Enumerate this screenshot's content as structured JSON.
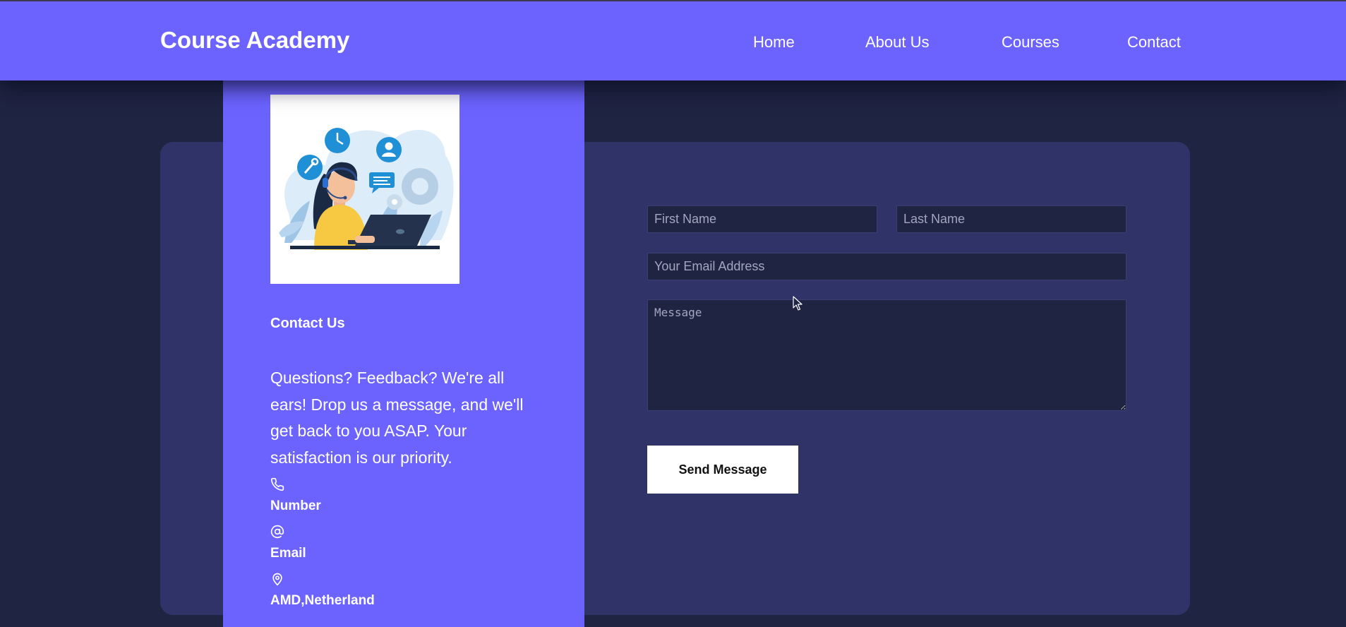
{
  "header": {
    "brand": "Course Academy",
    "nav": [
      "Home",
      "About Us",
      "Courses",
      "Contact"
    ]
  },
  "contact_panel": {
    "illustration": "support-agent-illustration",
    "title": "Contact Us",
    "text": "Questions? Feedback? We're all ears! Drop us a message, and we'll get back to you ASAP. Your satisfaction is our priority.",
    "items": [
      {
        "icon": "phone-icon",
        "label": "Number"
      },
      {
        "icon": "at-icon",
        "label": "Email"
      },
      {
        "icon": "location-pin-icon",
        "label": "AMD,Netherland"
      }
    ]
  },
  "form": {
    "first_name_placeholder": "First Name",
    "last_name_placeholder": "Last Name",
    "email_placeholder": "Your Email Address",
    "message_placeholder": "Message",
    "submit_label": "Send Message"
  },
  "colors": {
    "navbar": "#6c63ff",
    "page_background": "#1f2442",
    "card": "#2f3367",
    "panel": "#6c63ff",
    "input_background": "#1f2442",
    "button": "#ffffff"
  }
}
